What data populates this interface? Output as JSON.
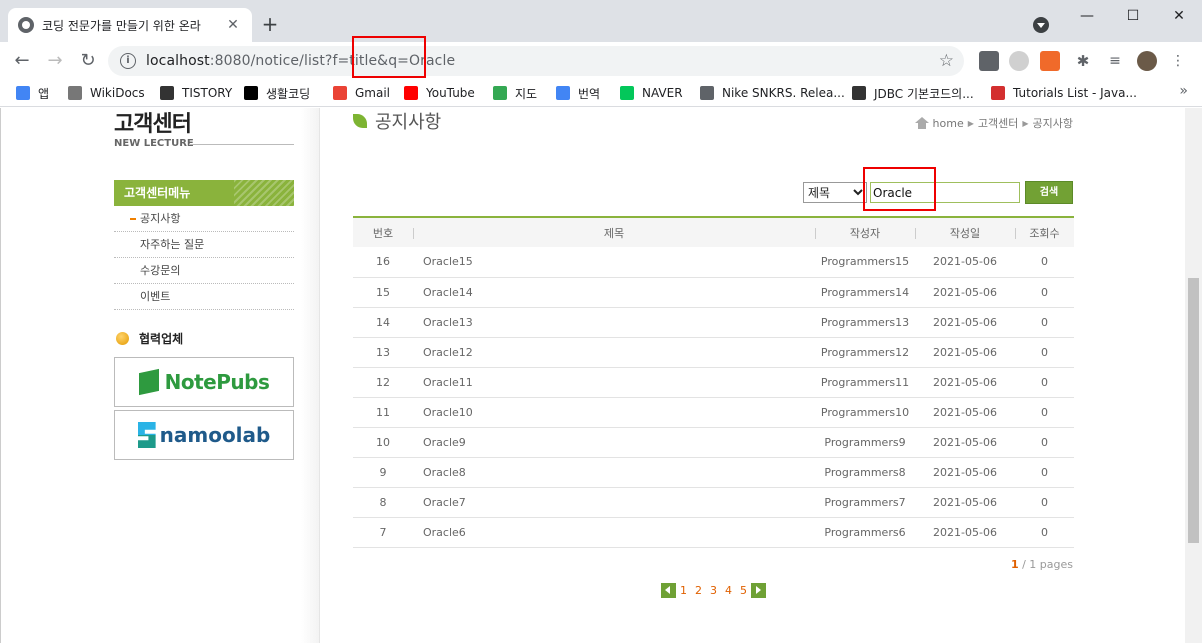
{
  "browser": {
    "tab_title": "코딩 전문가를 만들기 위한 온라",
    "url_host": "localhost",
    "url_rest": ":8080/notice/list?f=title&q=Oracle",
    "bookmarks": [
      {
        "label": "앱",
        "icon": "apps-grid-icon",
        "color": "#4285f4"
      },
      {
        "label": "WikiDocs",
        "icon": "wikidocs-icon",
        "color": "#777777"
      },
      {
        "label": "TISTORY",
        "icon": "tistory-icon",
        "color": "#333333"
      },
      {
        "label": "생활코딩",
        "icon": "circle-icon",
        "color": "#000000"
      },
      {
        "label": "Gmail",
        "icon": "gmail-icon",
        "color": "#ea4335"
      },
      {
        "label": "YouTube",
        "icon": "youtube-icon",
        "color": "#ff0000"
      },
      {
        "label": "지도",
        "icon": "maps-icon",
        "color": "#34a853"
      },
      {
        "label": "번역",
        "icon": "translate-icon",
        "color": "#4285f4"
      },
      {
        "label": "NAVER",
        "icon": "naver-icon",
        "color": "#03c75a"
      },
      {
        "label": "Nike SNKRS. Relea...",
        "icon": "globe-icon",
        "color": "#5f6368"
      },
      {
        "label": "JDBC 기본코드의...",
        "icon": "tistory-icon",
        "color": "#333333"
      },
      {
        "label": "Tutorials List - Java...",
        "icon": "tutorials-icon",
        "color": "#d32f2f"
      }
    ]
  },
  "sidebar": {
    "title": "고객센터",
    "subtitle": "NEW LECTURE",
    "menu_head": "고객센터메뉴",
    "menu_items": [
      "공지사항",
      "자주하는 질문",
      "수강문의",
      "이벤트"
    ],
    "partner_title": "협력업체",
    "partners": [
      "NotePubs",
      "namoolab"
    ]
  },
  "main": {
    "page_title": "공지사항",
    "breadcrumb": [
      "home",
      "고객센터",
      "공지사항"
    ],
    "search": {
      "field_options": [
        "제목"
      ],
      "query": "Oracle",
      "button_label": "검색"
    },
    "columns": [
      "번호",
      "제목",
      "작성자",
      "작성일",
      "조회수"
    ],
    "rows": [
      {
        "id": "16",
        "title": "Oracle15",
        "writer": "Programmers15",
        "date": "2021-05-06",
        "hits": "0"
      },
      {
        "id": "15",
        "title": "Oracle14",
        "writer": "Programmers14",
        "date": "2021-05-06",
        "hits": "0"
      },
      {
        "id": "14",
        "title": "Oracle13",
        "writer": "Programmers13",
        "date": "2021-05-06",
        "hits": "0"
      },
      {
        "id": "13",
        "title": "Oracle12",
        "writer": "Programmers12",
        "date": "2021-05-06",
        "hits": "0"
      },
      {
        "id": "12",
        "title": "Oracle11",
        "writer": "Programmers11",
        "date": "2021-05-06",
        "hits": "0"
      },
      {
        "id": "11",
        "title": "Oracle10",
        "writer": "Programmers10",
        "date": "2021-05-06",
        "hits": "0"
      },
      {
        "id": "10",
        "title": "Oracle9",
        "writer": "Programmers9",
        "date": "2021-05-06",
        "hits": "0"
      },
      {
        "id": "9",
        "title": "Oracle8",
        "writer": "Programmers8",
        "date": "2021-05-06",
        "hits": "0"
      },
      {
        "id": "8",
        "title": "Oracle7",
        "writer": "Programmers7",
        "date": "2021-05-06",
        "hits": "0"
      },
      {
        "id": "7",
        "title": "Oracle6",
        "writer": "Programmers6",
        "date": "2021-05-06",
        "hits": "0"
      }
    ],
    "page_current": "1",
    "page_total": "/ 1 pages",
    "pages": [
      "1",
      "2",
      "3",
      "4",
      "5"
    ]
  },
  "colors": {
    "accent_green": "#8ab33c",
    "page_orange": "#e06000",
    "highlight_red": "#ee0000"
  }
}
